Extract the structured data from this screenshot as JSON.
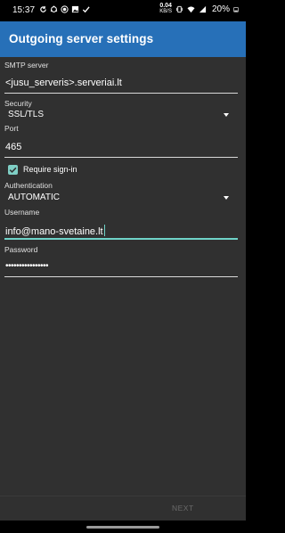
{
  "status_bar": {
    "time": "15:37",
    "net_speed_value": "0.04",
    "net_speed_unit": "KB/S",
    "battery": "20%",
    "left_icons": [
      "sync-icon",
      "ubuntu-icon",
      "record-icon",
      "image-icon",
      "check-icon"
    ],
    "right_icons": [
      "vibrate-icon",
      "wifi-icon",
      "signal-icon",
      "battery-icon"
    ]
  },
  "app_bar": {
    "title": "Outgoing server settings"
  },
  "form": {
    "smtp_server": {
      "label": "SMTP server",
      "value": "<jusu_serveris>.serveriai.lt"
    },
    "security": {
      "label": "Security",
      "value": "SSL/TLS"
    },
    "port": {
      "label": "Port",
      "value": "465"
    },
    "require_signin": {
      "label": "Require sign-in",
      "checked": true
    },
    "authentication": {
      "label": "Authentication",
      "value": "AUTOMATIC"
    },
    "username": {
      "label": "Username",
      "value": "info@mano-svetaine.lt"
    },
    "password": {
      "label": "Password",
      "value": "••••••••••••••••"
    }
  },
  "bottom": {
    "next_label": "NEXT"
  },
  "colors": {
    "app_bar": "#2770b8",
    "accent": "#6fd3c8",
    "background": "#303030"
  }
}
